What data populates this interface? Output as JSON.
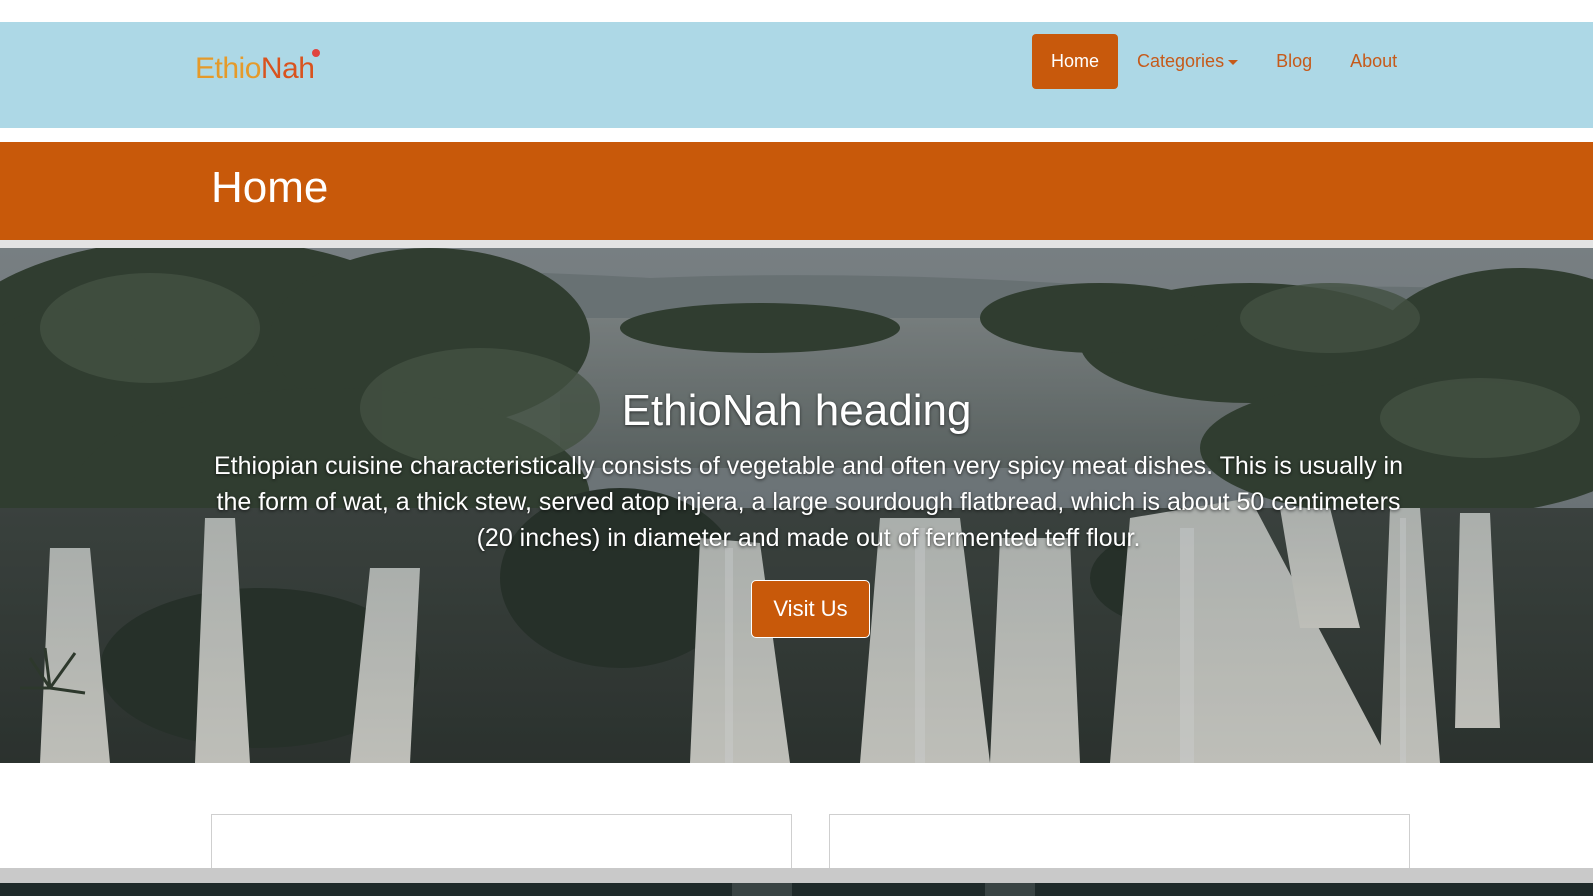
{
  "brand": {
    "name_part1": "Ethio",
    "name_part2": "Nah",
    "colors": {
      "part1": "#e59a2a",
      "part2": "#d9531e",
      "dot": "#e0443e"
    }
  },
  "nav": {
    "items": [
      {
        "label": "Home",
        "active": true
      },
      {
        "label": "Categories",
        "dropdown": true
      },
      {
        "label": "Blog"
      },
      {
        "label": "About"
      }
    ]
  },
  "page_header": {
    "title": "Home"
  },
  "hero": {
    "heading": "EthioNah heading",
    "text": "Ethiopian cuisine characteristically consists of vegetable and often very spicy meat dishes. This is usually in the form of wat, a thick stew, served atop injera, a large sourdough flatbread, which is about 50 centimeters (20 inches) in diameter and made out of fermented teff flour.",
    "button_label": "Visit Us",
    "background": "waterfall landscape photo"
  },
  "colors": {
    "navbar_bg": "#add8e6",
    "accent": "#c8590a",
    "nav_link": "#c65a1a"
  }
}
